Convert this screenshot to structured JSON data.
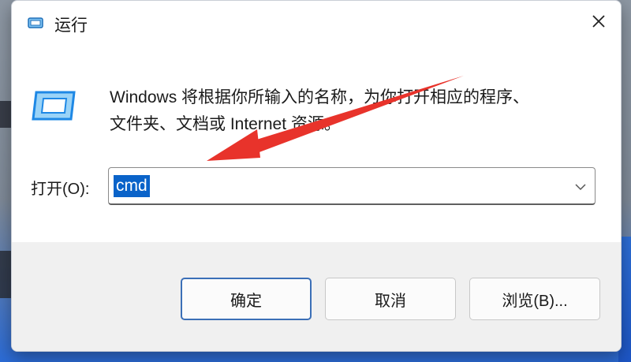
{
  "window": {
    "title": "运行",
    "app_icon": "run-dialog-icon",
    "close_icon": "close-icon"
  },
  "description": {
    "icon": "run-dialog-icon",
    "line1": "Windows 将根据你所输入的名称，为你打开相应的程序、",
    "line2": "文件夹、文档或 Internet 资源。"
  },
  "open_field": {
    "label": "打开(O):",
    "value": "cmd",
    "selected": true,
    "dropdown_icon": "chevron-down-icon"
  },
  "buttons": {
    "ok": "确定",
    "cancel": "取消",
    "browse": "浏览(B)..."
  },
  "annotation": {
    "type": "arrow",
    "color": "#e8332b",
    "points_to": "open-input"
  },
  "colors": {
    "selection": "#0a63c9",
    "default_button_border": "#3b6fb7",
    "icon_blue": "#1e88e5"
  }
}
